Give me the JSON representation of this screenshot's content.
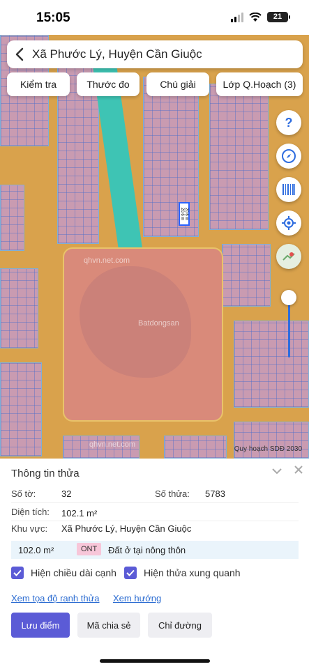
{
  "status": {
    "time": "15:05",
    "battery": "21"
  },
  "header": {
    "title": "Xã Phước Lý, Huyện Cần Giuộc"
  },
  "toolbar": [
    "Kiểm tra",
    "Thước đo",
    "Chú giải",
    "Lớp Q.Hoạch (3)"
  ],
  "map": {
    "watermark_top": "qhvn.net.com",
    "watermark_bottom": "qhvn.net.com",
    "center_watermark": "Batdongsan",
    "plot_label": "20.6 m 20.6 m",
    "scale_label": "Quy hoạch SDĐ 2030",
    "right_icons": [
      "help-icon",
      "compass-icon",
      "barcode-icon",
      "locate-icon",
      "map-layer-icon"
    ],
    "colors": {
      "road": "#e29a2e",
      "residential": "#c99bb1",
      "park": "#d98a7a",
      "canal": "#3ec4b4",
      "accent": "#5b5bd6"
    }
  },
  "panel": {
    "title": "Thông tin thửa",
    "so_to_label": "Số tờ:",
    "so_to_value": "32",
    "so_thua_label": "Số thửa:",
    "so_thua_value": "5783",
    "dien_tich_label": "Diện tích:",
    "dien_tich_value": "102.1 m²",
    "khu_vuc_label": "Khu vực:",
    "khu_vuc_value": "Xã Phước Lý, Huyện Cần Giuộc",
    "zone": {
      "area": "102.0 m²",
      "code": "ONT",
      "description": "Đất ở tại nông thôn"
    },
    "checkbox_1": "Hiện chiều dài cạnh",
    "checkbox_2": "Hiện thửa xung quanh",
    "link_1": "Xem tọa độ ranh thửa",
    "link_2": "Xem hướng",
    "btn_save": "Lưu điểm",
    "btn_share": "Mã chia sẻ",
    "btn_direction": "Chỉ đường"
  }
}
